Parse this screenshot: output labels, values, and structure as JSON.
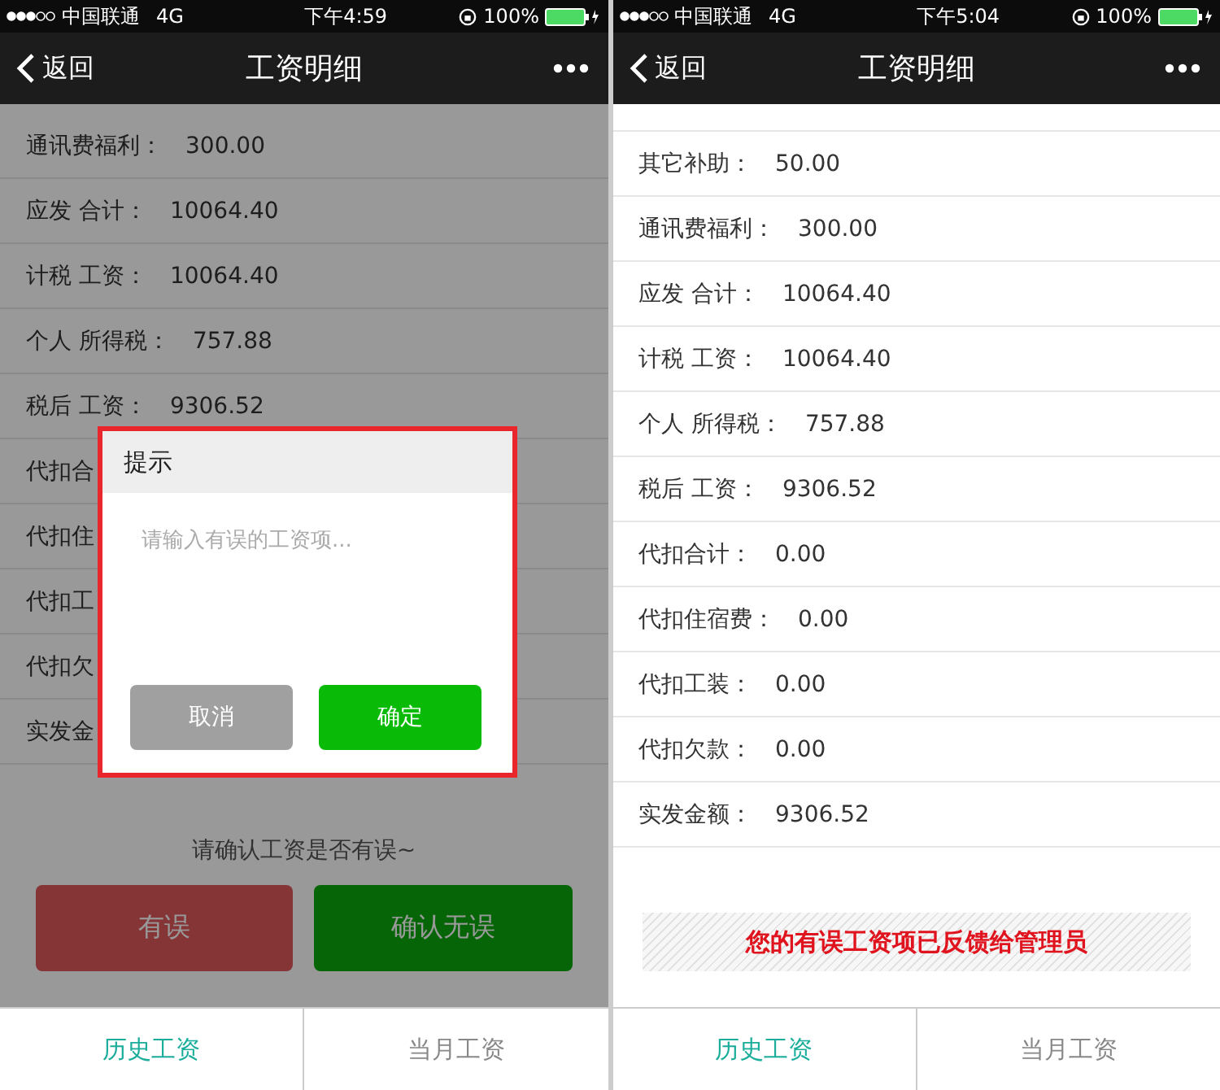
{
  "screens": [
    {
      "status_bar": {
        "carrier": "中国联通",
        "network": "4G",
        "time": "下午4:59",
        "battery": "100%"
      },
      "nav": {
        "back": "返回",
        "title": "工资明细"
      },
      "rows": [
        {
          "label": "通讯费福利：",
          "value": "300.00"
        },
        {
          "label": "应发 合计：",
          "value": "10064.40"
        },
        {
          "label": "计税 工资：",
          "value": "10064.40"
        },
        {
          "label": "个人 所得税：",
          "value": "757.88"
        },
        {
          "label": "税后 工资：",
          "value": "9306.52"
        },
        {
          "label": "代扣合"
        },
        {
          "label": "代扣住"
        },
        {
          "label": "代扣工"
        },
        {
          "label": "代扣欠"
        },
        {
          "label": "实发金"
        }
      ],
      "dimmed": true,
      "dialog": {
        "title": "提示",
        "placeholder": "请输入有误的工资项...",
        "buttons": [
          {
            "label": "取消",
            "kind": "cancel"
          },
          {
            "label": "确定",
            "kind": "confirm"
          }
        ]
      },
      "prompt": "请确认工资是否有误~",
      "actions": [
        {
          "label": "有误",
          "kind": "error"
        },
        {
          "label": "确认无误",
          "kind": "confirm"
        }
      ],
      "tabs": [
        {
          "label": "历史工资",
          "selected": true
        },
        {
          "label": "当月工资",
          "selected": false
        }
      ]
    },
    {
      "status_bar": {
        "carrier": "中国联通",
        "network": "4G",
        "time": "下午5:04",
        "battery": "100%"
      },
      "nav": {
        "back": "返回",
        "title": "工资明细"
      },
      "rows": [
        {
          "label": "其它补助：",
          "value": "50.00"
        },
        {
          "label": "通讯费福利：",
          "value": "300.00"
        },
        {
          "label": "应发 合计：",
          "value": "10064.40"
        },
        {
          "label": "计税 工资：",
          "value": "10064.40"
        },
        {
          "label": "个人 所得税：",
          "value": "757.88"
        },
        {
          "label": "税后 工资：",
          "value": "9306.52"
        },
        {
          "label": "代扣合计：",
          "value": "0.00"
        },
        {
          "label": "代扣住宿费：",
          "value": "0.00"
        },
        {
          "label": "代扣工装：",
          "value": "0.00"
        },
        {
          "label": "代扣欠款：",
          "value": "0.00"
        },
        {
          "label": "实发金额：",
          "value": "9306.52"
        }
      ],
      "dimmed": false,
      "notice": "您的有误工资项已反馈给管理员",
      "tabs": [
        {
          "label": "历史工资",
          "selected": true
        },
        {
          "label": "当月工资",
          "selected": false
        }
      ]
    }
  ]
}
